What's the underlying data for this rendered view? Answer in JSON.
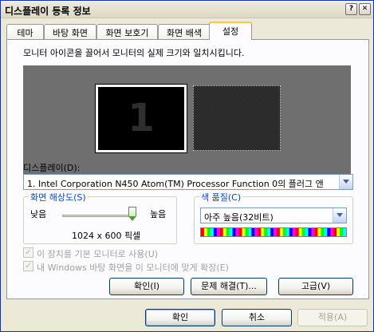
{
  "window": {
    "title": "디스플레이 등록 정보",
    "help_label": "?",
    "close_label": "✕"
  },
  "tabs": [
    {
      "label": "테마",
      "active": false
    },
    {
      "label": "바탕 화면",
      "active": false
    },
    {
      "label": "화면 보호기",
      "active": false
    },
    {
      "label": "화면 배색",
      "active": false
    },
    {
      "label": "설정",
      "active": true
    }
  ],
  "settings": {
    "instruction": "모니터 아이콘을 끌어서 모니터의 실제 크기와 일치시킵니다.",
    "monitors": [
      {
        "number": "1"
      }
    ],
    "display_label": "디스플레이(D):",
    "display_value": "1.  Intel Corporation N450 Atom(TM) Processor Function 0의 플러그 앤",
    "resolution": {
      "group_label": "화면 해상도(S)",
      "low_label": "낮음",
      "high_label": "높음",
      "value": "1024 x 600 픽셀",
      "slider_fraction": 1.0
    },
    "color_quality": {
      "group_label": "색 품질(C)",
      "selected": "아주 높음(32비트)"
    },
    "checkboxes": [
      {
        "label": "이 장치를 기본 모니터로 사용(U)",
        "checked": true,
        "enabled": false
      },
      {
        "label": "내 Windows 바탕 화면을 이 모니터에 맞게 확장(E)",
        "checked": true,
        "enabled": false
      }
    ],
    "buttons": {
      "identify": "확인(I)",
      "troubleshoot": "문제 해결(T)...",
      "advanced": "고급(V)"
    }
  },
  "dialog_buttons": {
    "ok": "확인",
    "cancel": "취소",
    "apply": "적용(A)"
  },
  "colors": {
    "title_accent": "#0046d5",
    "preview_bg": "#6f6f6f",
    "tab_highlight": "#ffc73c"
  }
}
